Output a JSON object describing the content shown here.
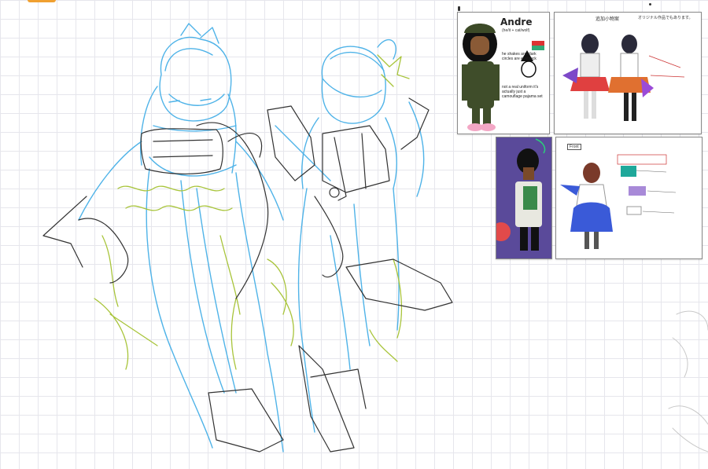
{
  "canvas": {
    "name": "sketch-canvas",
    "background": "#ffffff",
    "grid_color": "#e6e6ec"
  },
  "colors": {
    "sketch_blue": "#4fb3e8",
    "sketch_green": "#a8c43a",
    "sketch_dark": "#333333",
    "accent_orange": "#f0a030"
  },
  "references": {
    "andre": {
      "name": "Andre",
      "subtitle": "(he/it + cat/wolf)",
      "note1": "he shakes and dark circles are eyeblack",
      "note2": "not a real uniform it's actually just a camouflage pajama set"
    },
    "outfit": {
      "title": "追加小物案",
      "author": "オリジナル作品でもあります。"
    },
    "green": {},
    "blue": {
      "label": "Front"
    }
  }
}
